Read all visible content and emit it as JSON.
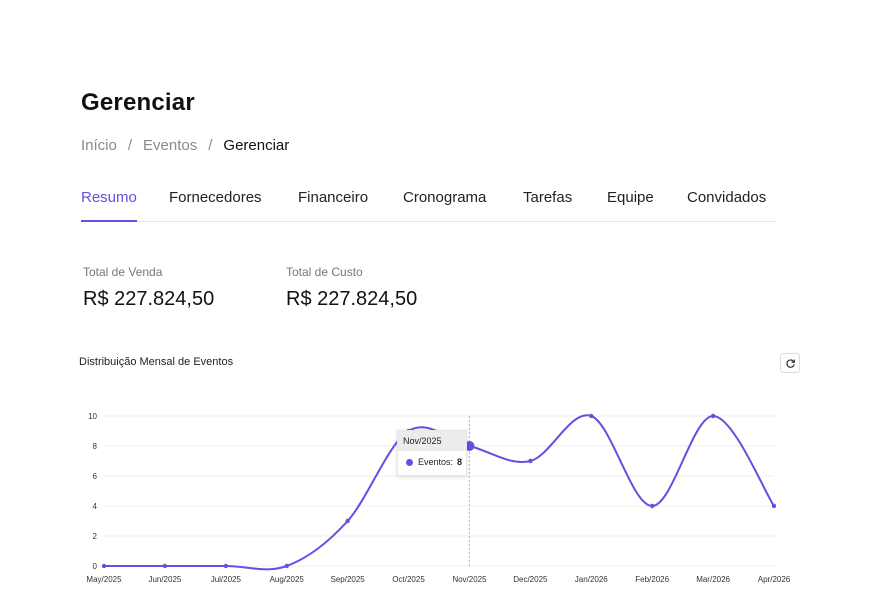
{
  "page": {
    "title": "Gerenciar"
  },
  "breadcrumb": {
    "items": [
      "Início",
      "Eventos"
    ],
    "current": "Gerenciar"
  },
  "tabs": [
    {
      "label": "Resumo",
      "active": true
    },
    {
      "label": "Fornecedores",
      "active": false
    },
    {
      "label": "Financeiro",
      "active": false
    },
    {
      "label": "Cronograma",
      "active": false
    },
    {
      "label": "Tarefas",
      "active": false
    },
    {
      "label": "Equipe",
      "active": false
    },
    {
      "label": "Convidados",
      "active": false
    }
  ],
  "stats": {
    "sales": {
      "label": "Total de Venda",
      "value": "R$ 227.824,50"
    },
    "cost": {
      "label": "Total de Custo",
      "value": "R$ 227.824,50"
    }
  },
  "chart_section": {
    "title": "Distribuição Mensal de Eventos",
    "refresh_icon": "refresh-icon"
  },
  "tooltip": {
    "title": "Nov/2025",
    "series_label": "Eventos:",
    "value": "8"
  },
  "colors": {
    "accent": "#6a4ce0",
    "grid": "#ececec"
  },
  "chart_data": {
    "type": "line",
    "smooth": true,
    "categories": [
      "May/2025",
      "Jun/2025",
      "Jul/2025",
      "Aug/2025",
      "Sep/2025",
      "Oct/2025",
      "Nov/2025",
      "Dec/2025",
      "Jan/2026",
      "Feb/2026",
      "Mar/2026",
      "Apr/2026"
    ],
    "series": [
      {
        "name": "Eventos",
        "values": [
          0,
          0,
          0,
          0,
          3,
          9,
          8,
          7,
          10,
          4,
          10,
          4
        ]
      }
    ],
    "yticks": [
      0,
      2,
      4,
      6,
      8,
      10
    ],
    "ylim": [
      0,
      10
    ],
    "grid": true,
    "highlighted_category": "Nov/2025"
  }
}
